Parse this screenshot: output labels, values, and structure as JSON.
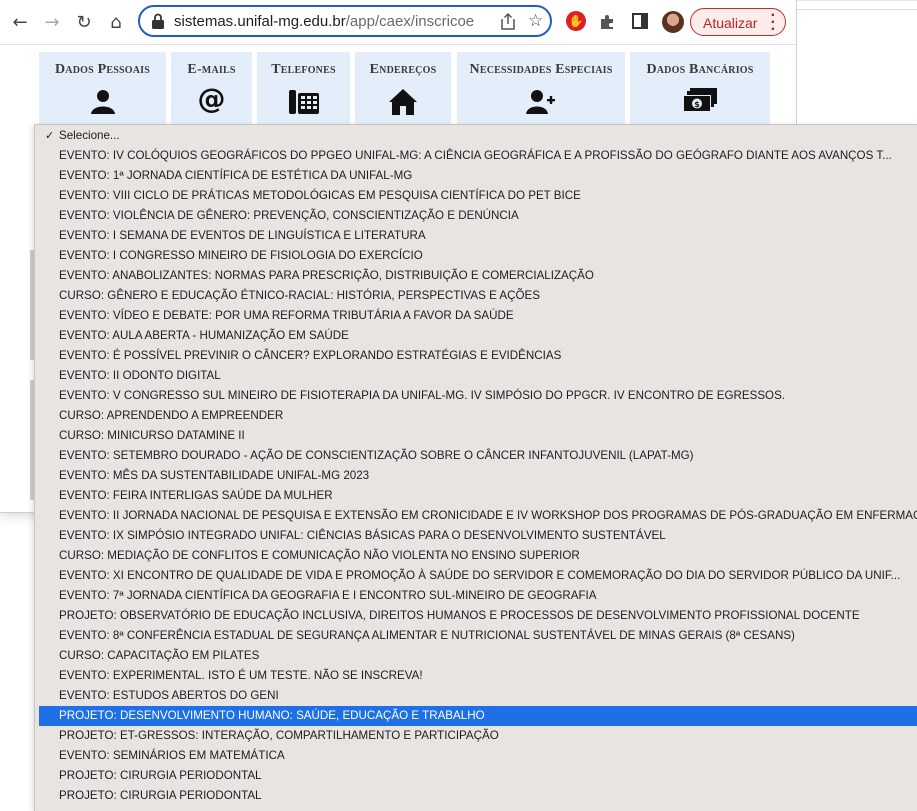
{
  "browser": {
    "url_host": "sistemas.unifal-mg.edu.br",
    "url_path": "/app/caex/inscricoe...",
    "update_label": "Atualizar"
  },
  "tabs": [
    {
      "label": "Dados Pessoais",
      "icon": "person-icon"
    },
    {
      "label": "E-mails",
      "icon": "at-icon"
    },
    {
      "label": "Telefones",
      "icon": "phone-icon"
    },
    {
      "label": "Endereços",
      "icon": "home-icon"
    },
    {
      "label": "Necessidades Especiais",
      "icon": "add-user-icon"
    },
    {
      "label": "Dados Bancários",
      "icon": "money-icon"
    }
  ],
  "dropdown": {
    "selected_index": 29,
    "options": [
      "Selecione...",
      "EVENTO: IV COLÓQUIOS GEOGRÁFICOS DO PPGEO UNIFAL-MG: A CIÊNCIA GEOGRÁFICA E A PROFISSÃO DO GEÓGRAFO DIANTE AOS AVANÇOS T...",
      "EVENTO: 1ª JORNADA CIENTÍFICA DE ESTÉTICA DA UNIFAL-MG",
      "EVENTO: VIII CICLO DE PRÁTICAS METODOLÓGICAS EM PESQUISA CIENTÍFICA DO PET BICE",
      "EVENTO: VIOLÊNCIA DE GÊNERO: PREVENÇÃO, CONSCIENTIZAÇÃO E DENÚNCIA",
      "EVENTO: I SEMANA DE EVENTOS DE LINGUÍSTICA E LITERATURA",
      "EVENTO: I CONGRESSO MINEIRO DE FISIOLOGIA DO EXERCÍCIO",
      "EVENTO: ANABOLIZANTES: NORMAS PARA PRESCRIÇÃO, DISTRIBUIÇÃO E COMERCIALIZAÇÃO",
      "CURSO: GÊNERO E EDUCAÇÃO ÉTNICO-RACIAL: HISTÓRIA, PERSPECTIVAS E AÇÕES",
      "EVENTO: VÍDEO E DEBATE: POR UMA REFORMA TRIBUTÁRIA A FAVOR DA SAÚDE",
      "EVENTO: AULA ABERTA - HUMANIZAÇÃO EM SAÚDE",
      "EVENTO: É POSSÍVEL PREVINIR O CÂNCER? EXPLORANDO ESTRATÉGIAS E EVIDÊNCIAS",
      "EVENTO: II ODONTO DIGITAL",
      "EVENTO: V CONGRESSO SUL MINEIRO DE FISIOTERAPIA DA UNIFAL-MG. IV SIMPÓSIO DO PPGCR. IV ENCONTRO DE EGRESSOS.",
      "CURSO: APRENDENDO A EMPREENDER",
      "CURSO: MINICURSO DATAMINE II",
      "EVENTO: SETEMBRO DOURADO - AÇÃO DE CONSCIENTIZAÇÃO SOBRE O CÂNCER INFANTOJUVENIL (LAPAT-MG)",
      "EVENTO: MÊS DA SUSTENTABILIDADE UNIFAL-MG 2023",
      "EVENTO: FEIRA INTERLIGAS SAÚDE DA MULHER",
      "EVENTO: II JORNADA NACIONAL DE PESQUISA E EXTENSÃO EM CRONICIDADE E IV WORKSHOP DOS PROGRAMAS DE PÓS-GRADUAÇÃO EM ENFERMAGEM",
      "EVENTO: IX SIMPÓSIO INTEGRADO UNIFAL: CIÊNCIAS BÁSICAS PARA O DESENVOLVIMENTO SUSTENTÁVEL",
      "CURSO: MEDIAÇÃO DE CONFLITOS E COMUNICAÇÃO NÃO VIOLENTA NO ENSINO SUPERIOR",
      "EVENTO: XI ENCONTRO DE QUALIDADE DE VIDA E PROMOÇÃO À SAÚDE DO SERVIDOR E COMEMORAÇÃO DO DIA DO SERVIDOR PÚBLICO DA UNIF...",
      "EVENTO: 7ª JORNADA CIENTÍFICA DA GEOGRAFIA E I ENCONTRO SUL-MINEIRO DE GEOGRAFIA",
      "PROJETO: OBSERVATÓRIO DE EDUCAÇÃO INCLUSIVA, DIREITOS HUMANOS E PROCESSOS DE DESENVOLVIMENTO PROFISSIONAL DOCENTE",
      "EVENTO: 8ª CONFERÊNCIA ESTADUAL DE SEGURANÇA ALIMENTAR E NUTRICIONAL SUSTENTÁVEL DE MINAS GERAIS (8ª CESANS)",
      "CURSO: CAPACITAÇÃO EM PILATES",
      "EVENTO: EXPERIMENTAL. ISTO É UM TESTE. NÃO SE INSCREVA!",
      "EVENTO: ESTUDOS ABERTOS DO GENI",
      "PROJETO: DESENVOLVIMENTO HUMANO: SAÚDE, EDUCAÇÃO E TRABALHO",
      "PROJETO: ET-GRESSOS: INTERAÇÃO, COMPARTILHAMENTO E PARTICIPAÇÃO",
      "EVENTO: SEMINÁRIOS EM MATEMÁTICA",
      "PROJETO: CIRURGIA PERIODONTAL",
      "PROJETO: CIRURGIA PERIODONTAL"
    ]
  }
}
